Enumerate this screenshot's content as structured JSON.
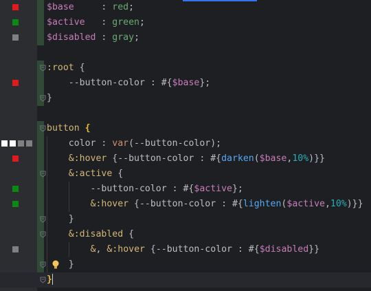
{
  "colors": {
    "red": "#e01b1b",
    "green": "#0b8a13",
    "gray": "#808080",
    "white": "#ffffff",
    "light_gray": "#a0a0a0"
  },
  "lines": [
    {
      "segs": [
        [
          "var",
          "$base"
        ],
        [
          "plain",
          "     : "
        ],
        [
          "str",
          "red"
        ],
        [
          "plain",
          ";"
        ]
      ]
    },
    {
      "segs": [
        [
          "var",
          "$active"
        ],
        [
          "plain",
          "   : "
        ],
        [
          "str",
          "green"
        ],
        [
          "plain",
          ";"
        ]
      ]
    },
    {
      "segs": [
        [
          "var",
          "$disabled"
        ],
        [
          "plain",
          " : "
        ],
        [
          "str",
          "gray"
        ],
        [
          "plain",
          ";"
        ]
      ]
    },
    {
      "segs": []
    },
    {
      "segs": [
        [
          "sel",
          ":root"
        ],
        [
          "plain",
          " {"
        ]
      ]
    },
    {
      "segs": [
        [
          "plain",
          "    --button-color : #{"
        ],
        [
          "var",
          "$base"
        ],
        [
          "plain",
          "};"
        ]
      ]
    },
    {
      "segs": [
        [
          "plain",
          "}"
        ]
      ]
    },
    {
      "segs": []
    },
    {
      "segs": [
        [
          "sel",
          "button"
        ],
        [
          "plain",
          " "
        ],
        [
          "brace",
          "{"
        ]
      ]
    },
    {
      "segs": [
        [
          "plain",
          "    color : "
        ],
        [
          "kw",
          "var"
        ],
        [
          "plain",
          "(--button-color);"
        ]
      ]
    },
    {
      "segs": [
        [
          "plain",
          "    "
        ],
        [
          "sel",
          "&:hover"
        ],
        [
          "plain",
          " {--button-color : #{"
        ],
        [
          "fn",
          "darken"
        ],
        [
          "plain",
          "("
        ],
        [
          "var",
          "$base"
        ],
        [
          "plain",
          ","
        ],
        [
          "num",
          "10%"
        ],
        [
          "plain",
          ")}}"
        ]
      ]
    },
    {
      "segs": [
        [
          "plain",
          "    "
        ],
        [
          "sel",
          "&:active"
        ],
        [
          "plain",
          " {"
        ]
      ]
    },
    {
      "segs": [
        [
          "plain",
          "        --button-color : #{"
        ],
        [
          "var",
          "$active"
        ],
        [
          "plain",
          "};"
        ]
      ]
    },
    {
      "segs": [
        [
          "plain",
          "        "
        ],
        [
          "sel",
          "&:hover"
        ],
        [
          "plain",
          " {--button-color : #{"
        ],
        [
          "fn",
          "lighten"
        ],
        [
          "plain",
          "("
        ],
        [
          "var",
          "$active"
        ],
        [
          "plain",
          ","
        ],
        [
          "num",
          "10%"
        ],
        [
          "plain",
          ")}}"
        ]
      ]
    },
    {
      "segs": [
        [
          "plain",
          "    }"
        ]
      ]
    },
    {
      "segs": [
        [
          "plain",
          "    "
        ],
        [
          "sel",
          "&:disabled"
        ],
        [
          "plain",
          " {"
        ]
      ]
    },
    {
      "segs": [
        [
          "plain",
          "        "
        ],
        [
          "sel",
          "&"
        ],
        [
          "plain",
          ", "
        ],
        [
          "sel",
          "&:hover"
        ],
        [
          "plain",
          " {--button-color : #{"
        ],
        [
          "var",
          "$disabled"
        ],
        [
          "plain",
          "}}"
        ]
      ]
    },
    {
      "segs": [
        [
          "plain",
          "    }"
        ]
      ]
    },
    {
      "segs": [
        [
          "brace",
          "}"
        ],
        [
          "cursor",
          ""
        ]
      ]
    }
  ],
  "swatches": [
    {
      "line": 0,
      "colors": [
        "red"
      ]
    },
    {
      "line": 1,
      "colors": [
        "green"
      ]
    },
    {
      "line": 2,
      "colors": [
        "gray"
      ]
    },
    {
      "line": 5,
      "colors": [
        "red"
      ]
    },
    {
      "line": 9,
      "colors": [
        "white",
        "white",
        "gray",
        "gray"
      ]
    },
    {
      "line": 10,
      "colors": [
        "red"
      ]
    },
    {
      "line": 12,
      "colors": [
        "green"
      ]
    },
    {
      "line": 13,
      "colors": [
        "green"
      ]
    },
    {
      "line": 16,
      "colors": [
        "gray"
      ]
    }
  ],
  "fold_markers": [
    4,
    6,
    8,
    11,
    14,
    15,
    17,
    18
  ],
  "current_line": 18,
  "intention_bulb_line": 17,
  "icons": {
    "color_swatch": "color-swatch-icon",
    "fold": "fold-arrow-icon",
    "bulb": "lightbulb-icon"
  }
}
